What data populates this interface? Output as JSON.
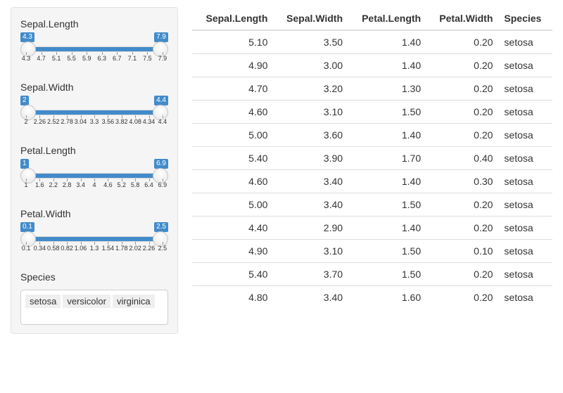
{
  "sidebar": {
    "sliders": [
      {
        "label": "Sepal.Length",
        "low": "4.3",
        "high": "7.9",
        "ticks": [
          "4.3",
          "4.7",
          "5.1",
          "5.5",
          "5.9",
          "6.3",
          "6.7",
          "7.1",
          "7.5",
          "7.9"
        ]
      },
      {
        "label": "Sepal.Width",
        "low": "2",
        "high": "4.4",
        "ticks": [
          "2",
          "2.26",
          "2.52",
          "2.78",
          "3.04",
          "3.3",
          "3.56",
          "3.82",
          "4.08",
          "4.34",
          "4.4"
        ]
      },
      {
        "label": "Petal.Length",
        "low": "1",
        "high": "6.9",
        "ticks": [
          "1",
          "1.6",
          "2.2",
          "2.8",
          "3.4",
          "4",
          "4.6",
          "5.2",
          "5.8",
          "6.4",
          "6.9"
        ]
      },
      {
        "label": "Petal.Width",
        "low": "0.1",
        "high": "2.5",
        "ticks": [
          "0.1",
          "0.34",
          "0.58",
          "0.82",
          "1.06",
          "1.3",
          "1.54",
          "1.78",
          "2.02",
          "2.26",
          "2.5"
        ]
      }
    ],
    "species": {
      "label": "Species",
      "items": [
        "setosa",
        "versicolor",
        "virginica"
      ]
    }
  },
  "table": {
    "headers": [
      "Sepal.Length",
      "Sepal.Width",
      "Petal.Length",
      "Petal.Width",
      "Species"
    ],
    "rows": [
      [
        "5.10",
        "3.50",
        "1.40",
        "0.20",
        "setosa"
      ],
      [
        "4.90",
        "3.00",
        "1.40",
        "0.20",
        "setosa"
      ],
      [
        "4.70",
        "3.20",
        "1.30",
        "0.20",
        "setosa"
      ],
      [
        "4.60",
        "3.10",
        "1.50",
        "0.20",
        "setosa"
      ],
      [
        "5.00",
        "3.60",
        "1.40",
        "0.20",
        "setosa"
      ],
      [
        "5.40",
        "3.90",
        "1.70",
        "0.40",
        "setosa"
      ],
      [
        "4.60",
        "3.40",
        "1.40",
        "0.30",
        "setosa"
      ],
      [
        "5.00",
        "3.40",
        "1.50",
        "0.20",
        "setosa"
      ],
      [
        "4.40",
        "2.90",
        "1.40",
        "0.20",
        "setosa"
      ],
      [
        "4.90",
        "3.10",
        "1.50",
        "0.10",
        "setosa"
      ],
      [
        "5.40",
        "3.70",
        "1.50",
        "0.20",
        "setosa"
      ],
      [
        "4.80",
        "3.40",
        "1.60",
        "0.20",
        "setosa"
      ]
    ]
  }
}
